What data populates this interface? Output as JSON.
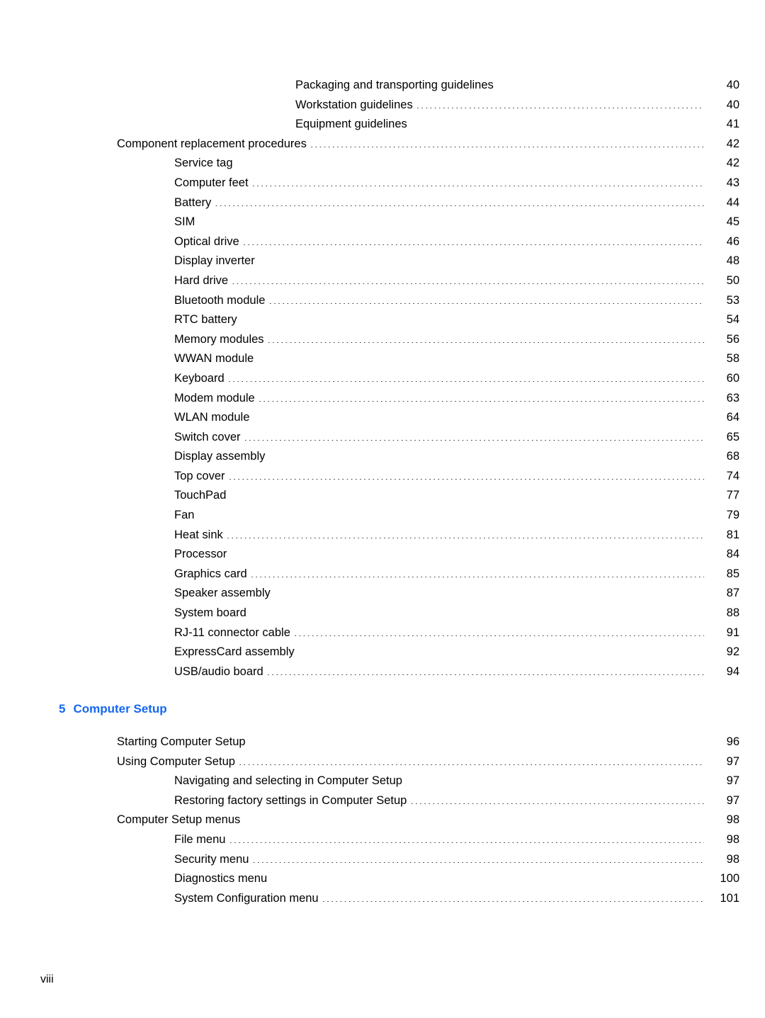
{
  "document": {
    "type": "table-of-contents",
    "folio": "viii"
  },
  "colors": {
    "chapter_heading": "#1567f0",
    "body_text": "#000000",
    "background": "#ffffff"
  },
  "toc": {
    "sections": [
      {
        "id": "continued-entries",
        "entries": [
          {
            "title": "Packaging and transporting guidelines",
            "page": "40",
            "level": 3
          },
          {
            "title": "Workstation guidelines",
            "page": "40",
            "level": 3
          },
          {
            "title": "Equipment guidelines",
            "page": "41",
            "level": 3
          },
          {
            "title": "Component replacement procedures",
            "page": "42",
            "level": 1
          },
          {
            "title": "Service tag",
            "page": "42",
            "level": 2
          },
          {
            "title": "Computer feet",
            "page": "43",
            "level": 2
          },
          {
            "title": "Battery",
            "page": "44",
            "level": 2
          },
          {
            "title": "SIM",
            "page": "45",
            "level": 2
          },
          {
            "title": "Optical drive",
            "page": "46",
            "level": 2
          },
          {
            "title": "Display inverter",
            "page": "48",
            "level": 2
          },
          {
            "title": "Hard drive",
            "page": "50",
            "level": 2
          },
          {
            "title": "Bluetooth module",
            "page": "53",
            "level": 2
          },
          {
            "title": "RTC battery",
            "page": "54",
            "level": 2
          },
          {
            "title": "Memory modules",
            "page": "56",
            "level": 2
          },
          {
            "title": "WWAN module",
            "page": "58",
            "level": 2
          },
          {
            "title": "Keyboard",
            "page": "60",
            "level": 2
          },
          {
            "title": "Modem module",
            "page": "63",
            "level": 2
          },
          {
            "title": "WLAN module",
            "page": "64",
            "level": 2
          },
          {
            "title": "Switch cover",
            "page": "65",
            "level": 2
          },
          {
            "title": "Display assembly",
            "page": "68",
            "level": 2
          },
          {
            "title": "Top cover",
            "page": "74",
            "level": 2
          },
          {
            "title": "TouchPad",
            "page": "77",
            "level": 2
          },
          {
            "title": "Fan",
            "page": "79",
            "level": 2
          },
          {
            "title": "Heat sink",
            "page": "81",
            "level": 2
          },
          {
            "title": "Processor",
            "page": "84",
            "level": 2
          },
          {
            "title": "Graphics card",
            "page": "85",
            "level": 2
          },
          {
            "title": "Speaker assembly",
            "page": "87",
            "level": 2
          },
          {
            "title": "System board",
            "page": "88",
            "level": 2
          },
          {
            "title": "RJ-11 connector cable",
            "page": "91",
            "level": 2
          },
          {
            "title": "ExpressCard assembly",
            "page": "92",
            "level": 2
          },
          {
            "title": "USB/audio board",
            "page": "94",
            "level": 2
          }
        ]
      }
    ],
    "chapter": {
      "number": "5",
      "title": "Computer Setup",
      "entries": [
        {
          "title": "Starting Computer Setup",
          "page": "96",
          "level": 1
        },
        {
          "title": "Using Computer Setup",
          "page": "97",
          "level": 1
        },
        {
          "title": "Navigating and selecting in Computer Setup",
          "page": "97",
          "level": 2
        },
        {
          "title": "Restoring factory settings in Computer Setup",
          "page": "97",
          "level": 2
        },
        {
          "title": "Computer Setup menus",
          "page": "98",
          "level": 1
        },
        {
          "title": "File menu",
          "page": "98",
          "level": 2
        },
        {
          "title": "Security menu",
          "page": "98",
          "level": 2
        },
        {
          "title": "Diagnostics menu",
          "page": "100",
          "level": 2
        },
        {
          "title": "System Configuration menu",
          "page": "101",
          "level": 2
        }
      ]
    }
  }
}
